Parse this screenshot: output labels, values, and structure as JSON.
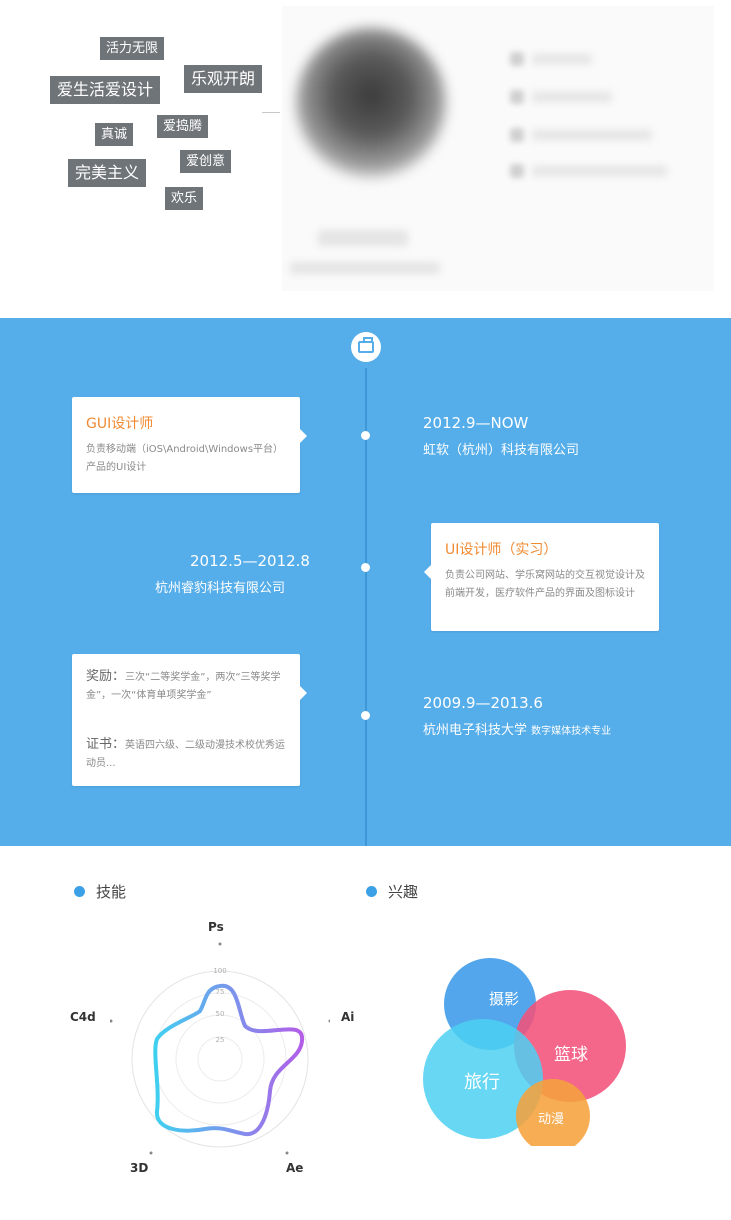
{
  "tags": [
    "活力无限",
    "爱生活爱设计",
    "乐观开朗",
    "真诚",
    "爱捣腾",
    "完美主义",
    "爱创意",
    "欢乐"
  ],
  "timeline": {
    "items": [
      {
        "date": "2012.9—NOW",
        "org": "虹软（杭州）科技有限公司",
        "card_title": "GUI设计师",
        "card_text": "负责移动端（iOS\\Android\\Windows平台）产品的UI设计"
      },
      {
        "date": "2012.5—2012.8",
        "org": "杭州睿豹科技有限公司",
        "card_title": "UI设计师（实习）",
        "card_text": "负责公司网站、学乐窝网站的交互视觉设计及前端开发，医疗软件产品的界面及图标设计"
      },
      {
        "date": "2009.9—2013.6",
        "org": "杭州电子科技大学",
        "org_sub": "数字媒体技术专业",
        "award_label": "奖励：",
        "award_text": "三次“二等奖学金”，两次“三等奖学金”，一次“体育单项奖学金”",
        "cert_label": "证书：",
        "cert_text": "英语四六级、二级动漫技术校优秀运动员..."
      }
    ]
  },
  "skills": {
    "title": "技能",
    "axes": [
      "Ps",
      "Ai",
      "Ae",
      "3D",
      "C4d"
    ],
    "scale_ticks": [
      "25",
      "50",
      "75",
      "100"
    ],
    "colors": {
      "gradient_start": "#3fd0f0",
      "gradient_end": "#b35de8",
      "accent": "#3ca0e6"
    }
  },
  "interests": {
    "title": "兴趣",
    "bubbles": [
      {
        "label": "摄影",
        "color": "#3b9ae8"
      },
      {
        "label": "篮球",
        "color": "#f2527a"
      },
      {
        "label": "旅行",
        "color": "#4cd0f2"
      },
      {
        "label": "动漫",
        "color": "#f5a23c"
      }
    ]
  }
}
